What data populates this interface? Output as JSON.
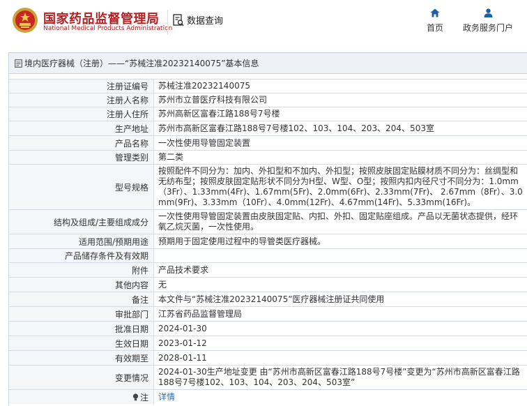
{
  "header": {
    "site_name": "国家药品监督管理局",
    "site_name_en": "National Medical Products Administration",
    "query_label": "数据查询",
    "nav": [
      {
        "label": "首页",
        "icon": "home-icon"
      },
      {
        "label": "政务服务门户",
        "icon": "user-icon"
      }
    ]
  },
  "panel": {
    "title": "境内医疗器械（注册）——“苏械注准20232140075”基本信息"
  },
  "fields": [
    {
      "label": "注册证编号",
      "value": "苏械注准20232140075"
    },
    {
      "label": "注册人名称",
      "value": "苏州市立普医疗科技有限公司"
    },
    {
      "label": "注册人住所",
      "value": "苏州高新区富春江路188号7号楼"
    },
    {
      "label": "生产地址",
      "value": "苏州市高新区富春江路188号7号楼102、103、104、203、204、503室"
    },
    {
      "label": "产品名称",
      "value": "一次性使用导管固定装置"
    },
    {
      "label": "管理类别",
      "value": "第二类"
    },
    {
      "label": "型号规格",
      "value": "按照配件不同分为：加内、外扣型和不加内、外扣型；按照皮肤固定贴膜材质不同分为：丝绸型和无纺布型；按照皮肤固定贴形状不同分为H型、W型、O型；按照内扣内径尺寸不同分为：1.0mm（3Fr）、1.33mm(4Fr)、1.67mm(5Fr)、2.0mm(6Fr)、2.33mm(7Fr)、 2.67mm（8Fr）、3.0mm(9Fr)、3.33mm（10Fr）、4.0mm(12Fr)、4.67mm(14Fr)、5.33mm(16Fr)。"
    },
    {
      "label": "结构及组成/主要组成成分",
      "value": "一次性使用导管固定装置由皮肤固定贴、内扣、外扣、固定贴座组成。产品以无菌状态提供，经环氧乙烷灭菌，一次性使用。"
    },
    {
      "label": "适用范围/预期用途",
      "value": "预期用于固定使用过程中的导管类医疗器械。"
    },
    {
      "label": "产品储存条件及有效期",
      "value": ""
    },
    {
      "label": "附件",
      "value": "产品技术要求"
    },
    {
      "label": "其他内容",
      "value": "无"
    },
    {
      "label": "备注",
      "value": "本文件与“苏械注准20232140075”医疗器械注册证共同使用"
    },
    {
      "label": "审批部门",
      "value": "江苏省药品监督管理局"
    },
    {
      "label": "批准日期",
      "value": "2024-01-30"
    },
    {
      "label": "生效日期",
      "value": "2023-01-12"
    },
    {
      "label": "有效期至",
      "value": "2028-01-11"
    },
    {
      "label": "变更情况",
      "value": "2024-01-30生产地址变更 由“苏州市高新区富春江路188号7号楼”变更为“苏州市高新区富春江路188号7号楼102、103、104、203、204、503室”"
    }
  ],
  "note": {
    "label": "注",
    "value": "详情",
    "icon": "bulb-icon"
  },
  "colors": {
    "brand": "#b41e20",
    "link": "#2b6fb7",
    "label_bg": "#f5f6f8",
    "title_bg": "#eef2f6"
  }
}
